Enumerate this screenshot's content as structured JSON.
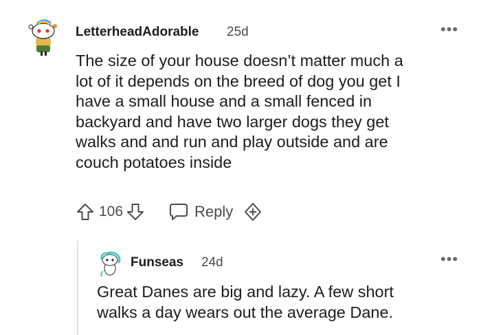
{
  "comment": {
    "username": "LetterheadAdorable",
    "age": "25d",
    "more_icon": "more-options-icon",
    "lines": [
      "The size of your house doesn’t matter much a",
      "lot of it depends on the breed of dog you get I",
      "have a small house and a small fenced in",
      "backyard and have two larger dogs they get",
      "walks and and run and play outside and are",
      "couch potatoes inside"
    ],
    "votes": "106",
    "reply_label": "Reply",
    "icons": {
      "upvote": "arrow-up-icon",
      "downvote": "arrow-down-icon",
      "reply": "speech-bubble-icon",
      "award": "award-plus-icon"
    }
  },
  "reply": {
    "username": "Funseas",
    "age": "24d",
    "lines": [
      "Great Danes are big and lazy. A few short",
      "walks a day wears out the average Dane."
    ]
  },
  "colors": {
    "text": "#1c1c1c",
    "meta": "#4a4a4a",
    "thread_line": "#e2e2e2"
  }
}
